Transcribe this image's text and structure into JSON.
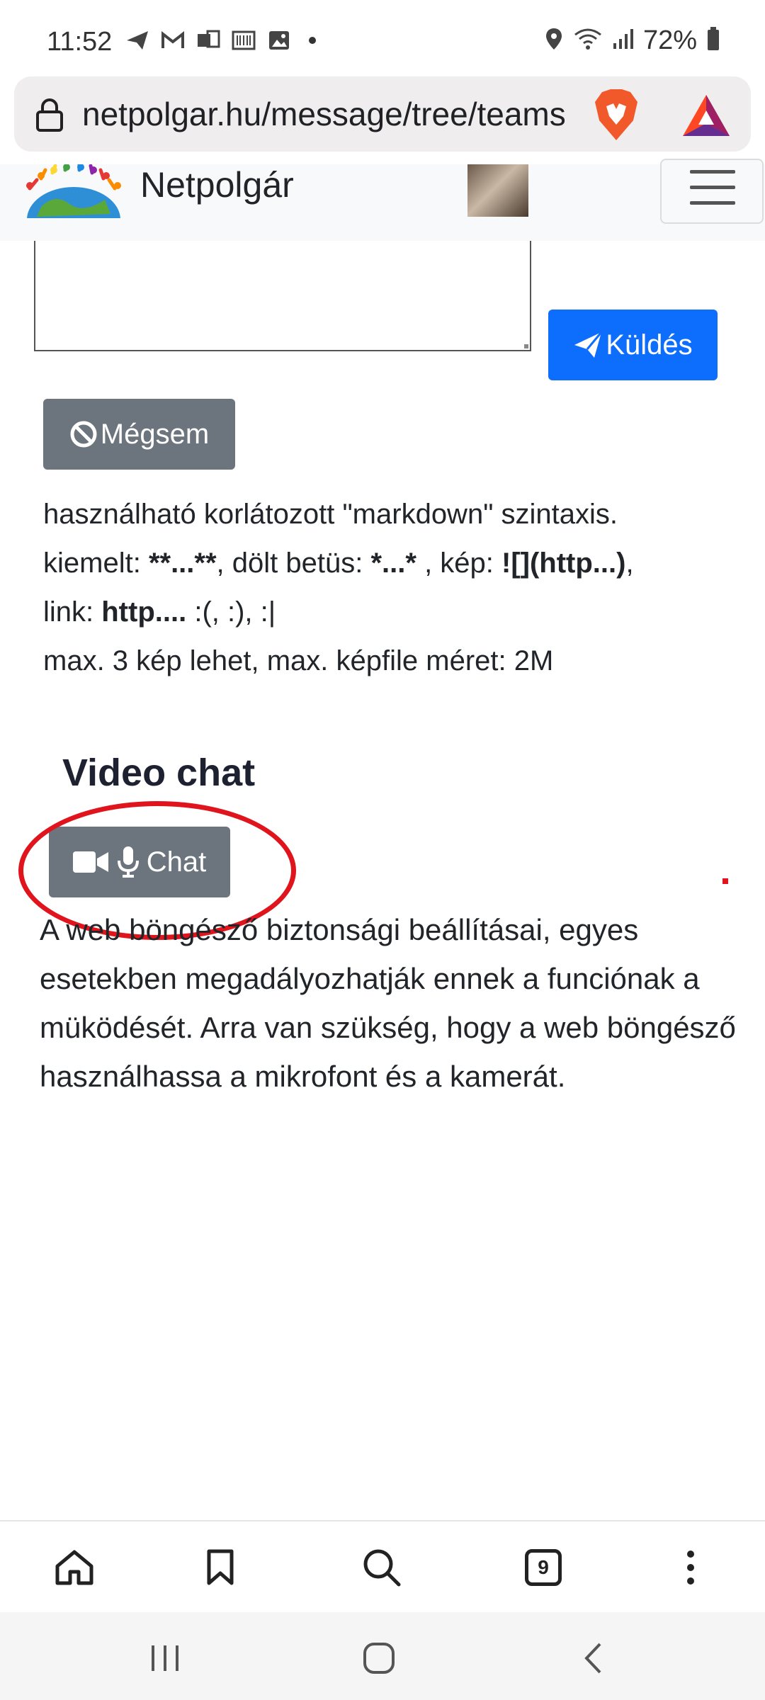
{
  "status_bar": {
    "time": "11:52",
    "battery": "72%"
  },
  "browser": {
    "url": "netpolgar.hu/message/tree/teams",
    "tabs_count": "9"
  },
  "site": {
    "brand": "Netpolgár"
  },
  "form": {
    "send_label": "Küldés",
    "cancel_label": "Mégsem"
  },
  "help": {
    "line1": "használható korlátozott \"markdown\" szintaxis.",
    "line2_a": "kiemelt: ",
    "line2_b": "**...**",
    "line2_c": ", dölt betüs: ",
    "line2_d": "*...*",
    "line2_e": " , kép: ",
    "line2_f": "![](http...)",
    "line2_g": ",",
    "line3_a": "link: ",
    "line3_b": "http....",
    "line3_c": " :(, :), :|",
    "line4": "max. 3 kép lehet, max. képfile méret: 2M"
  },
  "video_chat": {
    "title": "Video chat",
    "chat_label": "Chat",
    "notice": "A web böngésző biztonsági beállításai, egyes esetekben megadályozhatják ennek a funciónak a müködését. Arra van szükség, hogy a web böngésző használhassa a mikrofont és a kamerát."
  },
  "colors": {
    "primary": "#0d6efd",
    "secondary": "#6c757d",
    "annotation": "#e0141c"
  }
}
